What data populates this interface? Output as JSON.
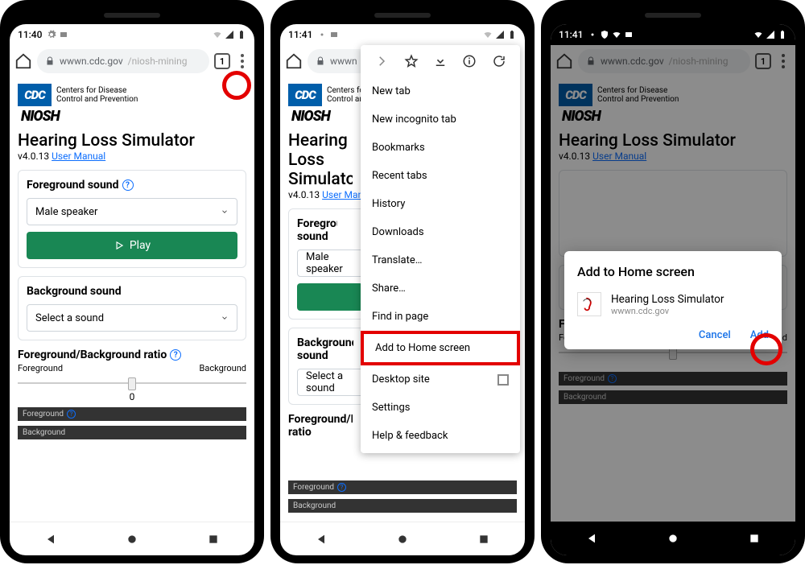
{
  "phones": {
    "p1": {
      "time": "11:40",
      "tabCount": "1"
    },
    "p2": {
      "time": "11:41",
      "tabCount": "1"
    },
    "p3": {
      "time": "11:41",
      "tabCount": "1"
    }
  },
  "url": {
    "host": "wwwn.cdc.gov",
    "path": "/niosh-mining",
    "short": "wwwn"
  },
  "cdc": {
    "logo": "CDC",
    "line1": "Centers for Disease",
    "line2": "Control and Prevention",
    "niosh": "NIOSH"
  },
  "app": {
    "title": "Hearing Loss Simulator",
    "version": "v4.0.13",
    "userManual": "User Manual"
  },
  "fg": {
    "title": "Foreground sound",
    "select": "Male speaker",
    "play": "Play"
  },
  "bg": {
    "title": "Background sound",
    "select": "Select a sound"
  },
  "ratio": {
    "title": "Foreground/Background ratio",
    "left": "Foreground",
    "right": "Background",
    "value": "0"
  },
  "rows": {
    "fg": "Foreground",
    "bg": "Background"
  },
  "menu": {
    "newTab": "New tab",
    "incognito": "New incognito tab",
    "bookmarks": "Bookmarks",
    "recent": "Recent tabs",
    "history": "History",
    "downloads": "Downloads",
    "translate": "Translate…",
    "share": "Share…",
    "find": "Find in page",
    "addHome": "Add to Home screen",
    "desktop": "Desktop site",
    "settings": "Settings",
    "help": "Help & feedback"
  },
  "dialog": {
    "title": "Add to Home screen",
    "appName": "Hearing Loss Simulator",
    "host": "wwwn.cdc.gov",
    "cancel": "Cancel",
    "add": "Add"
  }
}
